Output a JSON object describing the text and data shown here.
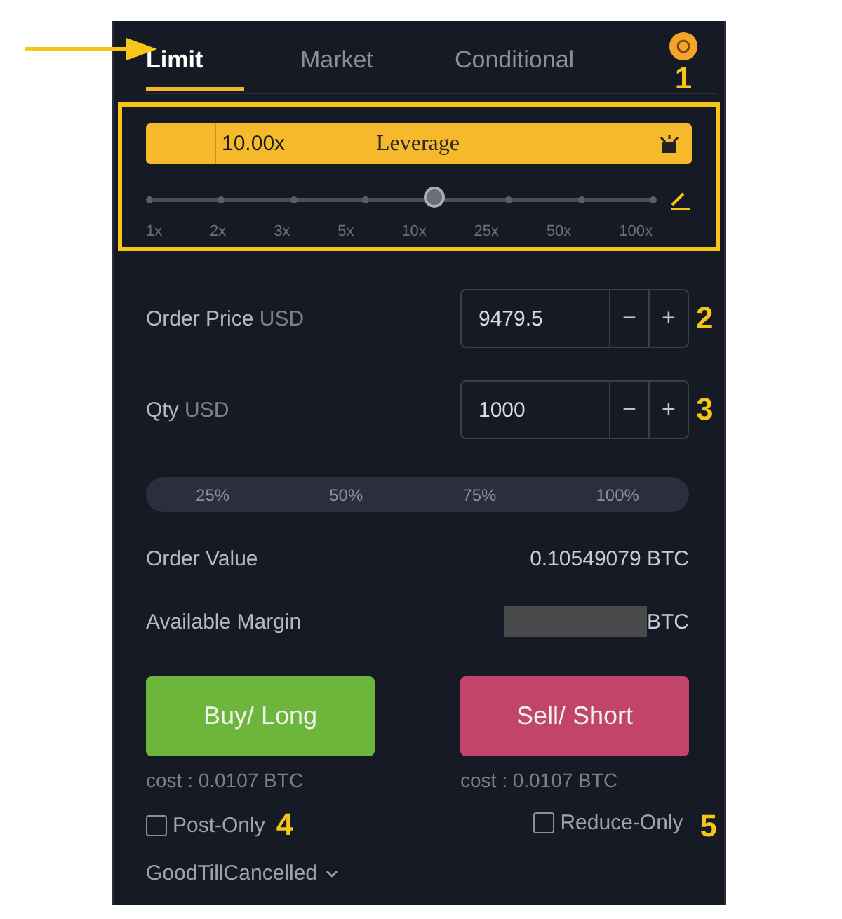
{
  "tabs": [
    {
      "label": "Limit",
      "selected": true
    },
    {
      "label": "Market",
      "selected": false
    },
    {
      "label": "Conditional",
      "selected": false
    }
  ],
  "annotations": [
    "1",
    "2",
    "3",
    "4",
    "5"
  ],
  "leverage": {
    "value": "10.00x",
    "label": "Leverage",
    "level": 0.571,
    "marks": [
      "1x",
      "2x",
      "3x",
      "5x",
      "10x",
      "25x",
      "50x",
      "100x"
    ]
  },
  "order_price": {
    "label": "Order Price",
    "unit": "USD",
    "value": "9479.5",
    "minus": "−",
    "plus": "+"
  },
  "qty": {
    "label": "Qty",
    "unit": "USD",
    "value": "1000",
    "minus": "−",
    "plus": "+"
  },
  "percent_buttons": [
    "25%",
    "50%",
    "75%",
    "100%"
  ],
  "order_value": {
    "label": "Order Value",
    "value": "0.10549079 BTC"
  },
  "available_margin": {
    "label": "Available Margin",
    "value": "BTC"
  },
  "buy": {
    "label": "Buy/ Long",
    "cost": "cost : 0.0107 BTC"
  },
  "sell": {
    "label": "Sell/ Short",
    "cost": "cost : 0.0107 BTC"
  },
  "post_only": {
    "label": "Post-Only",
    "checked": false
  },
  "reduce_only": {
    "label": "Reduce-Only",
    "checked": false
  },
  "time_in_force": "GoodTillCancelled"
}
